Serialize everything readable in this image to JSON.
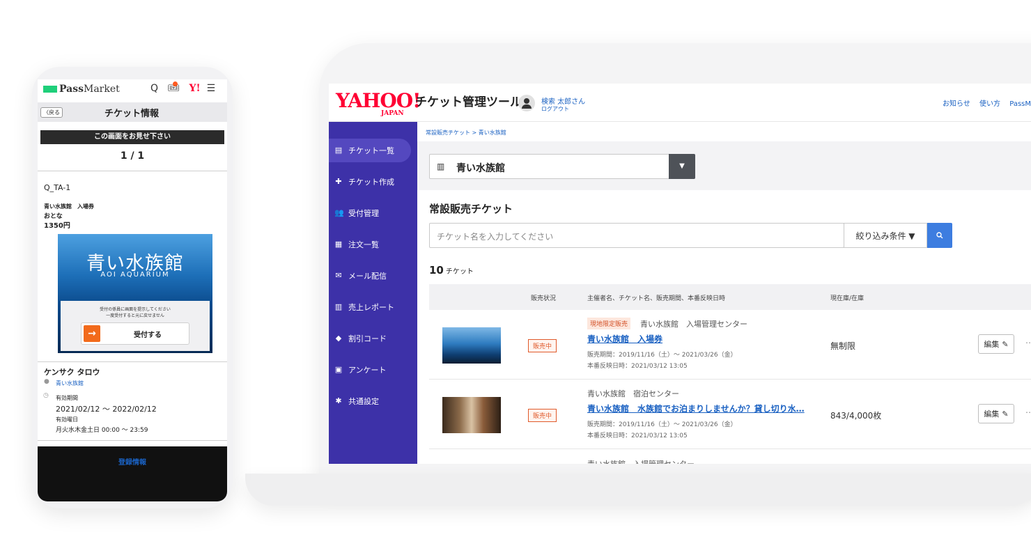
{
  "admin": {
    "header": {
      "logo_main": "YAHOO!",
      "logo_sub": "JAPAN",
      "tool_title": "チケット管理ツール",
      "user_name": "検索 太郎さん",
      "logout": "ログアウト",
      "links": [
        "お知らせ",
        "使い方",
        "PassM"
      ]
    },
    "sidebar": {
      "items": [
        {
          "label": "チケット一覧",
          "icon": "list-icon",
          "glyph": "▤",
          "active": true
        },
        {
          "label": "チケット作成",
          "icon": "create-ticket-icon",
          "glyph": "✚",
          "active": false
        },
        {
          "label": "受付管理",
          "icon": "people-icon",
          "glyph": "👥",
          "active": false
        },
        {
          "label": "注文一覧",
          "icon": "document-icon",
          "glyph": "▦",
          "active": false
        },
        {
          "label": "メール配信",
          "icon": "mail-icon",
          "glyph": "✉",
          "active": false
        },
        {
          "label": "売上レポート",
          "icon": "chart-icon",
          "glyph": "▥",
          "active": false
        },
        {
          "label": "割引コード",
          "icon": "tag-icon",
          "glyph": "◆",
          "active": false
        },
        {
          "label": "アンケート",
          "icon": "clipboard-icon",
          "glyph": "▣",
          "active": false
        },
        {
          "label": "共通設定",
          "icon": "gear-icon",
          "glyph": "✱",
          "active": false
        }
      ]
    },
    "breadcrumb": "常設販売チケット > 青い水族館",
    "venue_select": {
      "value": "青い水族館",
      "icon": "building-icon",
      "arrow": "▼"
    },
    "section_title": "常設販売チケット",
    "search": {
      "placeholder": "チケット名を入力してください",
      "filter_label": "絞り込み条件 ▼",
      "button_icon": "search-icon"
    },
    "count": {
      "number": "10",
      "unit": "チケット"
    },
    "table": {
      "headers": [
        "販売状況",
        "主催者名、チケット名、販売期間、本番反映日時",
        "現在庫/在庫"
      ],
      "rows": [
        {
          "status": "販売中",
          "tag": "現地限定販売",
          "organizer": "青い水族館　入場管理センター",
          "name": "青い水族館　入場券",
          "period": "販売期間：2019/11/16（土）～ 2021/03/26（金）",
          "release": "本番反映日時：2021/03/12 13:05",
          "stock": "無制限",
          "edit": "編集",
          "more": "⋯"
        },
        {
          "status": "販売中",
          "tag": "",
          "organizer": "青い水族館　宿泊センター",
          "name": "青い水族館　水族館でお泊まりしませんか？貸し切り水…",
          "period": "販売期間：2019/11/16（土）～ 2021/03/26（金）",
          "release": "本番反映日時：2021/03/12 13:05",
          "stock": "843/4,000枚",
          "edit": "編集",
          "more": "⋯"
        },
        {
          "status": "",
          "tag": "",
          "organizer": "青い水族館　入場管理センター",
          "name": "",
          "period": "",
          "release": "",
          "stock": "",
          "edit": "",
          "more": ""
        }
      ]
    }
  },
  "phone": {
    "brand_bold": "Pass",
    "brand_rest": "Market",
    "header_icons": [
      "Q",
      "🎟",
      "Y!",
      "☰"
    ],
    "back": "〈戻る",
    "page_title": "チケット情報",
    "notice": "この画面をお見せ下さい",
    "page_num": "1 / 1",
    "ticket_code": "Q_TA-1",
    "ticket_name": "青い水族館　入場券",
    "ticket_type": "おとな",
    "ticket_price": "1350円",
    "image_title": "青い水族館",
    "image_subtitle": "AOI AQUARIUM",
    "accept_msg_line1": "受付の係員に画面を提示してください",
    "accept_msg_line2": "一度受付すると元に戻せません",
    "accept_arrow": "→",
    "accept_label": "受付する",
    "holder": "ケンサク タロウ",
    "venue": "青い水族館",
    "valid_label": "有効期間",
    "valid_dates": "2021/02/12 ～ 2022/02/12",
    "day_label": "有効曜日",
    "day_value": "月火水木金土日 00:00 ～ 23:59",
    "footer": "登録情報"
  }
}
